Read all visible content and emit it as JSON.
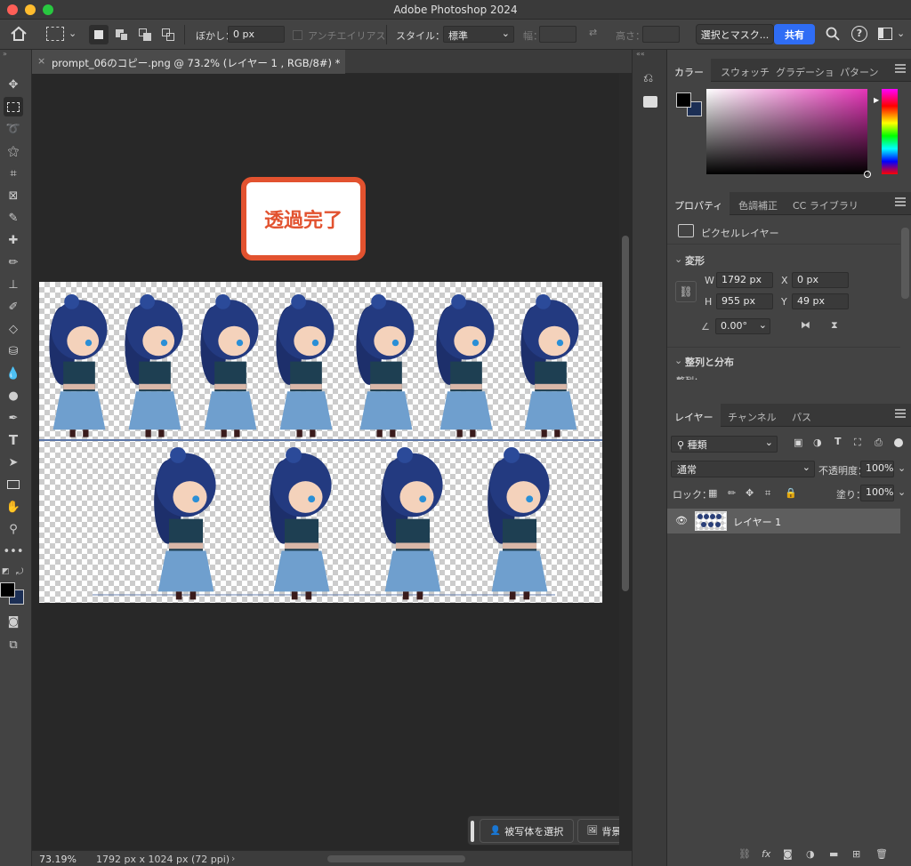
{
  "window": {
    "title": "Adobe Photoshop 2024"
  },
  "options": {
    "feather_label": "ぼかし：",
    "feather_value": "0 px",
    "antialias_label": "アンチエイリアス",
    "style_label": "スタイル：",
    "style_value": "標準",
    "width_label": "幅：",
    "height_label": "高さ：",
    "select_mask_button": "選択とマスク...",
    "share_button": "共有"
  },
  "document": {
    "tab_title": "prompt_06のコピー.png @ 73.2% (レイヤー 1 , RGB/8#) *",
    "callout_text": "透過完了"
  },
  "status": {
    "zoom": "73.19%",
    "doc_info": "1792 px x 1024 px (72 ppi)"
  },
  "taskbar": {
    "select_subject": "被写体を選択",
    "remove_bg": "背景を削除"
  },
  "color_panel": {
    "tabs": [
      "カラー",
      "スウォッチ",
      "グラデーショ",
      "パターン"
    ],
    "foreground": "#000000",
    "background": "#1c2f55"
  },
  "properties": {
    "tabs": [
      "プロパティ",
      "色調補正",
      "CC ライブラリ"
    ],
    "layer_type": "ピクセルレイヤー",
    "transform_title": "変形",
    "w_label": "W",
    "w_value": "1792 px",
    "h_label": "H",
    "h_value": "955 px",
    "x_label": "X",
    "x_value": "0 px",
    "y_label": "Y",
    "y_value": "49 px",
    "angle_value": "0.00°",
    "align_title": "整列と分布",
    "align_sub": "整列："
  },
  "layers": {
    "tabs": [
      "レイヤー",
      "チャンネル",
      "パス"
    ],
    "filter_kind": "種類",
    "blend_mode": "通常",
    "opacity_label": "不透明度：",
    "opacity_value": "100%",
    "lock_label": "ロック：",
    "fill_label": "塗り：",
    "fill_value": "100%",
    "items": [
      {
        "name": "レイヤー 1"
      }
    ]
  }
}
